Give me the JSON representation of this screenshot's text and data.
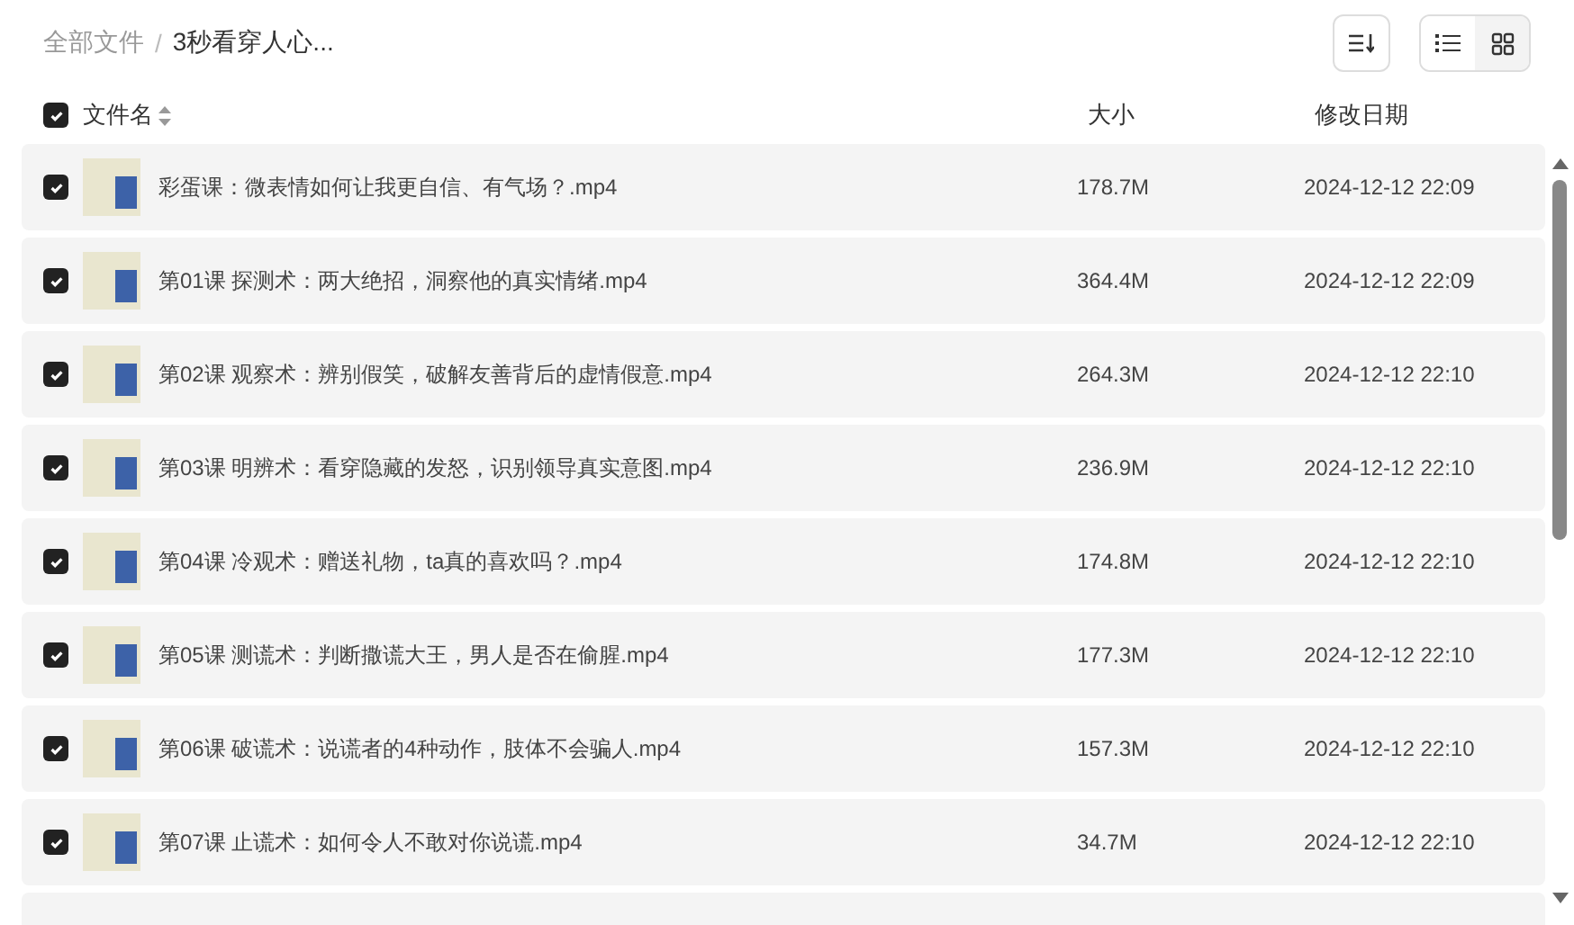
{
  "breadcrumb": [
    {
      "label": "全部文件",
      "current": false
    },
    {
      "label": "3秒看穿人心...",
      "current": true
    }
  ],
  "breadcrumb_separator": "/",
  "view_toggle": [
    {
      "kind": "list",
      "selected": true
    },
    {
      "kind": "grid",
      "selected": false
    }
  ],
  "header": {
    "checked": true,
    "columns": [
      "文件名",
      "大小",
      "修改日期"
    ]
  },
  "rows": [
    {
      "checked": true,
      "name": "彩蛋课：微表情如何让我更自信、有气场？.mp4",
      "size": "178.7M",
      "date": "2024-12-12 22:09"
    },
    {
      "checked": true,
      "name": "第01课 探测术：两大绝招，洞察他的真实情绪.mp4",
      "size": "364.4M",
      "date": "2024-12-12 22:09"
    },
    {
      "checked": true,
      "name": "第02课 观察术：辨别假笑，破解友善背后的虚情假意.mp4",
      "size": "264.3M",
      "date": "2024-12-12 22:10"
    },
    {
      "checked": true,
      "name": "第03课 明辨术：看穿隐藏的发怒，识别领导真实意图.mp4",
      "size": "236.9M",
      "date": "2024-12-12 22:10"
    },
    {
      "checked": true,
      "name": "第04课 冷观术：赠送礼物，ta真的喜欢吗？.mp4",
      "size": "174.8M",
      "date": "2024-12-12 22:10"
    },
    {
      "checked": true,
      "name": "第05课 测谎术：判断撒谎大王，男人是否在偷腥.mp4",
      "size": "177.3M",
      "date": "2024-12-12 22:10"
    },
    {
      "checked": true,
      "name": "第06课 破谎术：说谎者的4种动作，肢体不会骗人.mp4",
      "size": "157.3M",
      "date": "2024-12-12 22:10"
    },
    {
      "checked": true,
      "name": "第07课 止谎术：如何令人不敢对你说谎.mp4",
      "size": "34.7M",
      "date": "2024-12-12 22:10"
    }
  ]
}
